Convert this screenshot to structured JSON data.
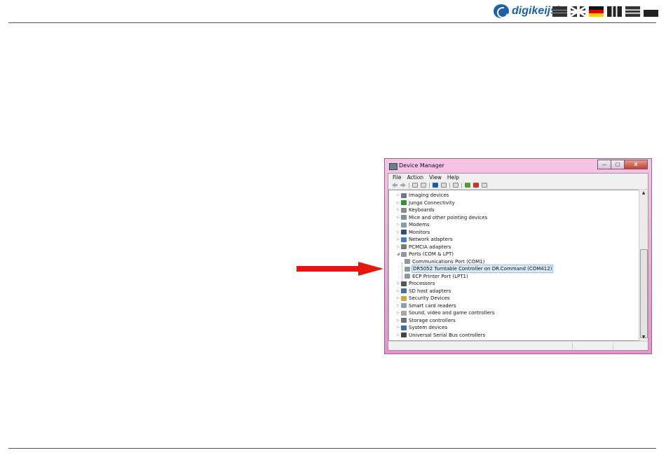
{
  "brand": {
    "name": "digikeijs",
    "mark": "®"
  },
  "flags": [
    "flag-nl",
    "flag-uk",
    "flag-de",
    "flag-fr",
    "flag-it",
    "flag-dk"
  ],
  "arrow": {
    "color": "#e8140e"
  },
  "window": {
    "title": "Device Manager",
    "buttons": {
      "minimize": "—",
      "maximize": "□",
      "close": "X"
    },
    "menu": [
      {
        "label": "File"
      },
      {
        "label": "Action"
      },
      {
        "label": "View"
      },
      {
        "label": "Help"
      }
    ],
    "tree": [
      {
        "label": "Imaging devices",
        "icon": "camera-icon",
        "expander": "▷"
      },
      {
        "label": "Jungo Connectivity",
        "icon": "jungo-icon",
        "expander": "▷"
      },
      {
        "label": "Keyboards",
        "icon": "keyboard-icon",
        "expander": "▷"
      },
      {
        "label": "Mice and other pointing devices",
        "icon": "mouse-icon",
        "expander": "▷"
      },
      {
        "label": "Modems",
        "icon": "modem-icon",
        "expander": "▷"
      },
      {
        "label": "Monitors",
        "icon": "monitor-icon",
        "expander": "▷"
      },
      {
        "label": "Network adapters",
        "icon": "network-icon",
        "expander": "▷"
      },
      {
        "label": "PCMCIA adapters",
        "icon": "pcmcia-icon",
        "expander": "▷"
      },
      {
        "label": "Ports (COM & LPT)",
        "icon": "port-icon",
        "expander": "◢"
      },
      {
        "label": "Communications Port (COM1)",
        "icon": "port-icon",
        "expander": ""
      },
      {
        "label": "DR5052 Turntable Controller on DR.Command (COM412)",
        "icon": "port-icon",
        "expander": "",
        "selected": true
      },
      {
        "label": "ECP Printer Port (LPT1)",
        "icon": "port-icon",
        "expander": ""
      },
      {
        "label": "Processors",
        "icon": "processor-icon",
        "expander": "▷"
      },
      {
        "label": "SD host adapters",
        "icon": "sd-icon",
        "expander": "▷"
      },
      {
        "label": "Security Devices",
        "icon": "security-icon",
        "expander": "▷"
      },
      {
        "label": "Smart card readers",
        "icon": "smartcard-icon",
        "expander": "▷"
      },
      {
        "label": "Sound, video and game controllers",
        "icon": "sound-icon",
        "expander": "▷"
      },
      {
        "label": "Storage controllers",
        "icon": "storage-icon",
        "expander": "▷"
      },
      {
        "label": "System devices",
        "icon": "system-icon",
        "expander": "▷"
      },
      {
        "label": "Universal Serial Bus controllers",
        "icon": "usb-icon",
        "expander": "▷"
      }
    ],
    "icon_colors": {
      "camera-icon": "#6c7b8a",
      "jungo-icon": "#2f8f3f",
      "keyboard-icon": "#8a8a8a",
      "mouse-icon": "#7d8fa0",
      "modem-icon": "#8b9aa8",
      "monitor-icon": "#2d4f7c",
      "network-icon": "#3c7fc4",
      "pcmcia-icon": "#7a7a7a",
      "port-icon": "#8d9aa6",
      "processor-icon": "#555555",
      "sd-icon": "#4a6f9a",
      "security-icon": "#d2a53a",
      "smartcard-icon": "#8aa0b8",
      "sound-icon": "#a7a7a7",
      "storage-icon": "#6f6f6f",
      "system-icon": "#3b6fb0",
      "usb-icon": "#444444"
    }
  }
}
